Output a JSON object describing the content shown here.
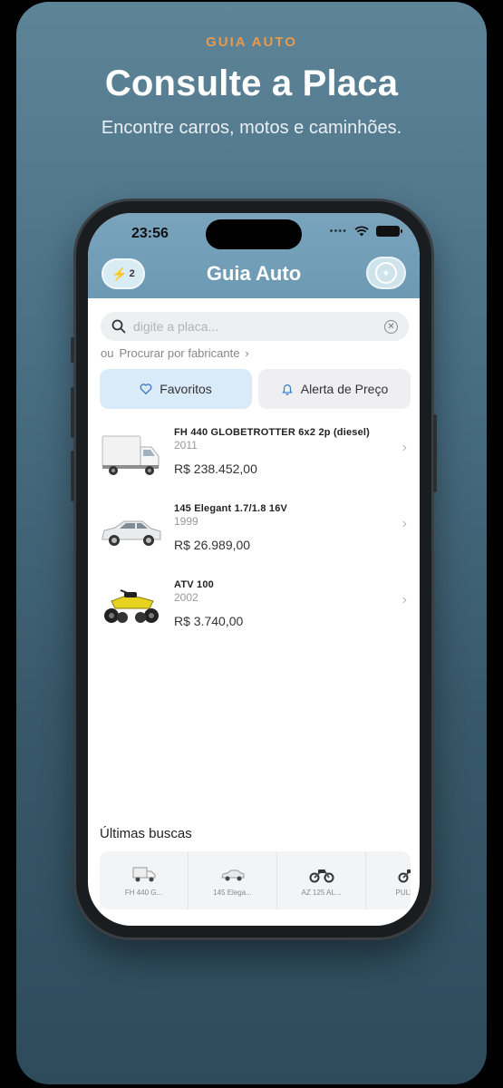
{
  "promo": {
    "brand": "GUIA AUTO",
    "headline": "Consulte a Placa",
    "subhead": "Encontre carros, motos e caminhões."
  },
  "status_bar": {
    "time": "23:56"
  },
  "header": {
    "title": "Guia Auto",
    "credits_count": "2",
    "credits_icon": "bolt-icon",
    "action_icon": "sparkle-icon"
  },
  "search": {
    "placeholder": "digite a placa...",
    "value": ""
  },
  "browse": {
    "prefix": "ou",
    "link_label": "Procurar por fabricante"
  },
  "segments": {
    "favorites_label": "Favoritos",
    "price_alert_label": "Alerta de Preço"
  },
  "vehicles": [
    {
      "model": "FH 440 GLOBETROTTER 6x2 2p (diesel)",
      "year": "2011",
      "price": "R$ 238.452,00",
      "type": "truck"
    },
    {
      "model": "145 Elegant 1.7/1.8 16V",
      "year": "1999",
      "price": "R$ 26.989,00",
      "type": "car"
    },
    {
      "model": "ATV 100",
      "year": "2002",
      "price": "R$ 3.740,00",
      "type": "atv"
    }
  ],
  "recent": {
    "title": "Últimas buscas",
    "items": [
      {
        "label": "FH 440 G...",
        "type": "truck"
      },
      {
        "label": "145 Elega...",
        "type": "car"
      },
      {
        "label": "AZ 125 AL...",
        "type": "motorcycle"
      },
      {
        "label": "PULSAR",
        "type": "motorcycle"
      }
    ]
  },
  "colors": {
    "brand_orange": "#e79a4a",
    "header_blue": "#6c99b3",
    "favorites_bg": "#d9eaf8"
  }
}
